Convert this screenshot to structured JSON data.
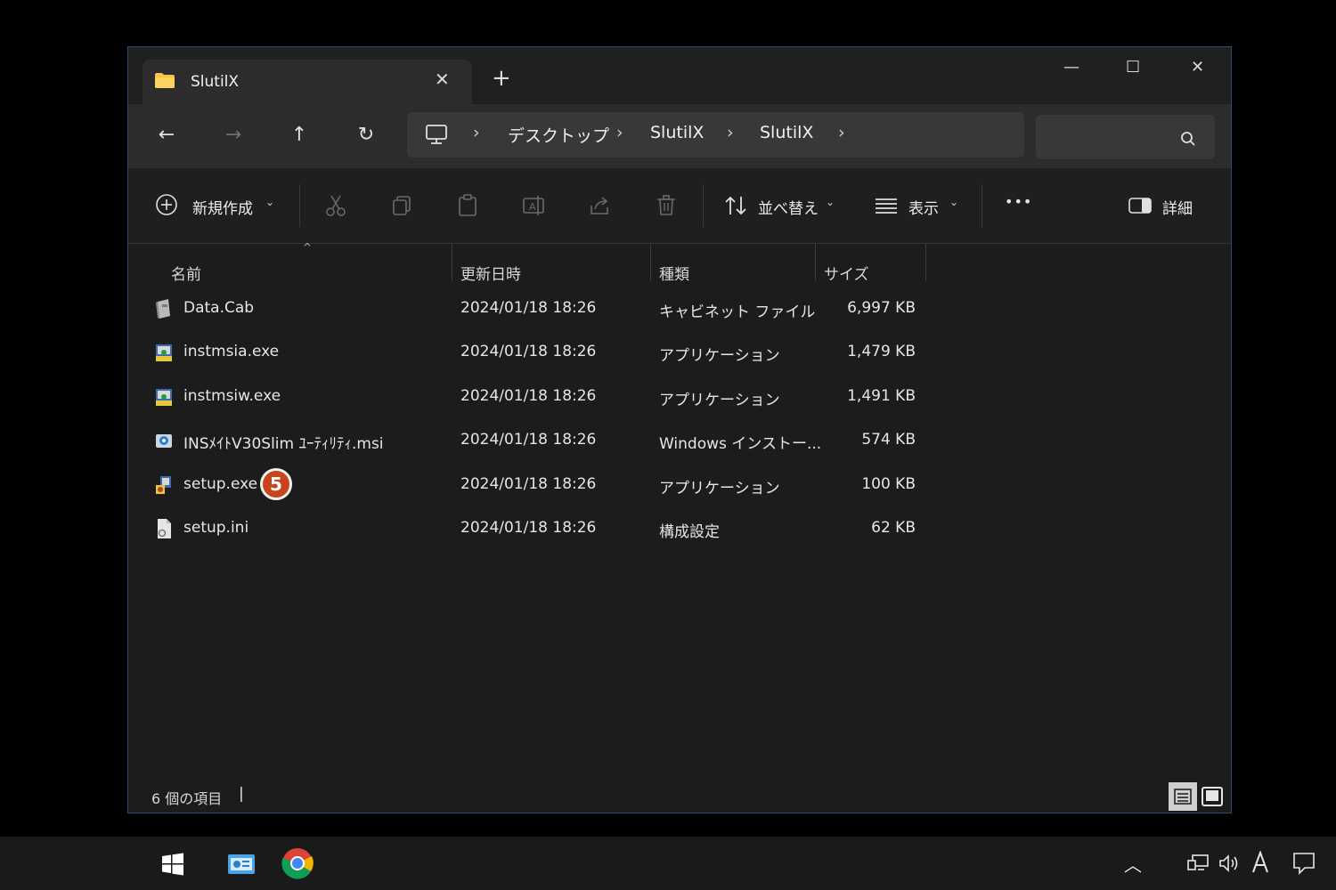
{
  "window": {
    "tab_title": "SlutilX",
    "close_tab_glyph": "✕",
    "new_tab_glyph": "+",
    "minimize_glyph": "—",
    "maximize_glyph": "☐",
    "close_glyph": "✕"
  },
  "nav": {
    "back_glyph": "←",
    "forward_glyph": "→",
    "up_glyph": "↑",
    "refresh_glyph": "↻",
    "breadcrumb": [
      "デスクトップ",
      "SlutilX",
      "SlutilX"
    ],
    "sep_glyph": "›"
  },
  "toolbar": {
    "new_label": "新規作成",
    "sort_label": "並べ替え",
    "view_label": "表示",
    "more_glyph": "•••",
    "details_label": "詳細"
  },
  "columns": {
    "name": "名前",
    "date": "更新日時",
    "type": "種類",
    "size": "サイズ"
  },
  "files": [
    {
      "name": "Data.Cab",
      "date": "2024/01/18 18:26",
      "type": "キャビネット ファイル",
      "size": "6,997 KB",
      "icon": "cabinet-file-icon"
    },
    {
      "name": "instmsia.exe",
      "date": "2024/01/18 18:26",
      "type": "アプリケーション",
      "size": "1,479 KB",
      "icon": "installer-exe-icon"
    },
    {
      "name": "instmsiw.exe",
      "date": "2024/01/18 18:26",
      "type": "アプリケーション",
      "size": "1,491 KB",
      "icon": "installer-exe-icon"
    },
    {
      "name": "INSﾒｲﾄV30Slim ﾕｰﾃｨﾘﾃｨ.msi",
      "date": "2024/01/18 18:26",
      "type": "Windows インストー...",
      "size": "574 KB",
      "icon": "msi-package-icon"
    },
    {
      "name": "setup.exe",
      "date": "2024/01/18 18:26",
      "type": "アプリケーション",
      "size": "100 KB",
      "icon": "setup-exe-icon"
    },
    {
      "name": "setup.ini",
      "date": "2024/01/18 18:26",
      "type": "構成設定",
      "size": "62 KB",
      "icon": "config-file-icon"
    }
  ],
  "annotation": {
    "step": "5"
  },
  "status": {
    "item_count": "6 個の項目",
    "cursor": "|"
  },
  "colors": {
    "accent_badge": "#c8451b",
    "window_bg": "#1c1c1c",
    "border": "#2b4a6e"
  }
}
